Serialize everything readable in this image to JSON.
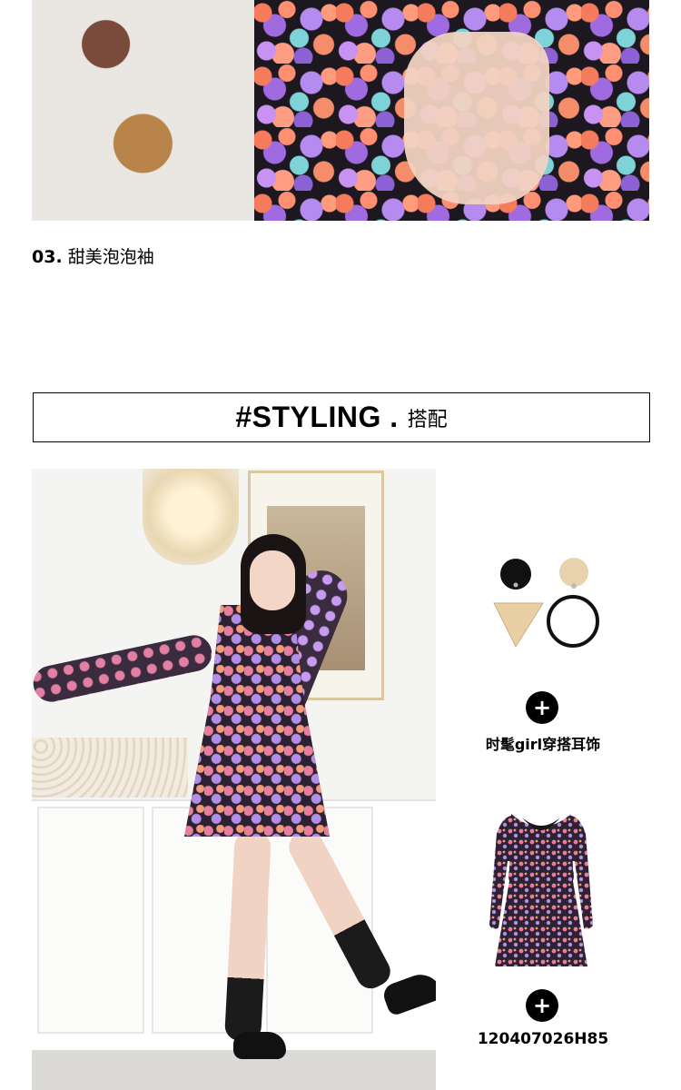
{
  "feature": {
    "number": "03.",
    "text": "甜美泡泡袖"
  },
  "styling": {
    "title": "#STYLING .",
    "subtitle": "搭配"
  },
  "products": [
    {
      "label": "时髦girl穿搭耳饰",
      "plus": "+"
    },
    {
      "label": "120407026H85",
      "plus": "+"
    }
  ],
  "colors": {
    "text": "#000000",
    "background": "#ffffff",
    "button": "#000000"
  }
}
